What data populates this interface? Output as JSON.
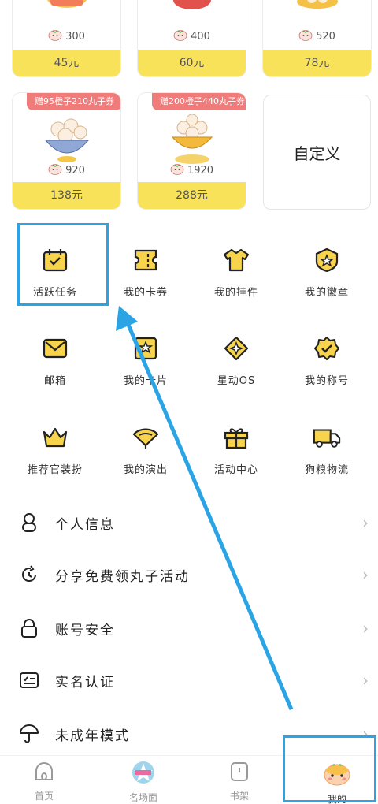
{
  "packages_top": [
    {
      "amount": "300",
      "price": "45元"
    },
    {
      "amount": "400",
      "price": "60元"
    },
    {
      "amount": "520",
      "price": "78元"
    }
  ],
  "packages_second": [
    {
      "badge": "赠95橙子210丸子券",
      "amount": "920",
      "price": "138元"
    },
    {
      "badge": "赠200橙子440丸子券",
      "amount": "1920",
      "price": "288元"
    }
  ],
  "custom_label": "自定义",
  "grid": [
    {
      "label": "活跃任务",
      "icon": "task-calendar-icon"
    },
    {
      "label": "我的卡券",
      "icon": "ticket-icon"
    },
    {
      "label": "我的挂件",
      "icon": "tshirt-icon"
    },
    {
      "label": "我的徽章",
      "icon": "badge-icon"
    },
    {
      "label": "邮箱",
      "icon": "mail-icon"
    },
    {
      "label": "我的卡片",
      "icon": "card-star-icon"
    },
    {
      "label": "星动OS",
      "icon": "diamond-star-icon"
    },
    {
      "label": "我的称号",
      "icon": "title-medal-icon"
    },
    {
      "label": "推荐官装扮",
      "icon": "crown-icon"
    },
    {
      "label": "我的演出",
      "icon": "fan-icon"
    },
    {
      "label": "活动中心",
      "icon": "gift-icon"
    },
    {
      "label": "狗粮物流",
      "icon": "truck-icon"
    }
  ],
  "list": [
    {
      "label": "个人信息",
      "icon": "person-icon"
    },
    {
      "label": "分享免费领丸子活动",
      "icon": "share-refresh-icon"
    },
    {
      "label": "账号安全",
      "icon": "lock-icon"
    },
    {
      "label": "实名认证",
      "icon": "id-card-icon"
    },
    {
      "label": "未成年模式",
      "icon": "umbrella-icon"
    }
  ],
  "tabs": [
    {
      "label": "首页",
      "icon": "home-icon"
    },
    {
      "label": "名场面",
      "icon": "scene-icon"
    },
    {
      "label": "书架",
      "icon": "bookshelf-icon"
    },
    {
      "label": "我的",
      "icon": "mine-avatar-icon"
    }
  ],
  "colors": {
    "accent_yellow": "#f8e25a",
    "badge_red": "#f07b7b",
    "highlight_blue": "#2aa4e4",
    "icon_yellow": "#f7d44c"
  }
}
